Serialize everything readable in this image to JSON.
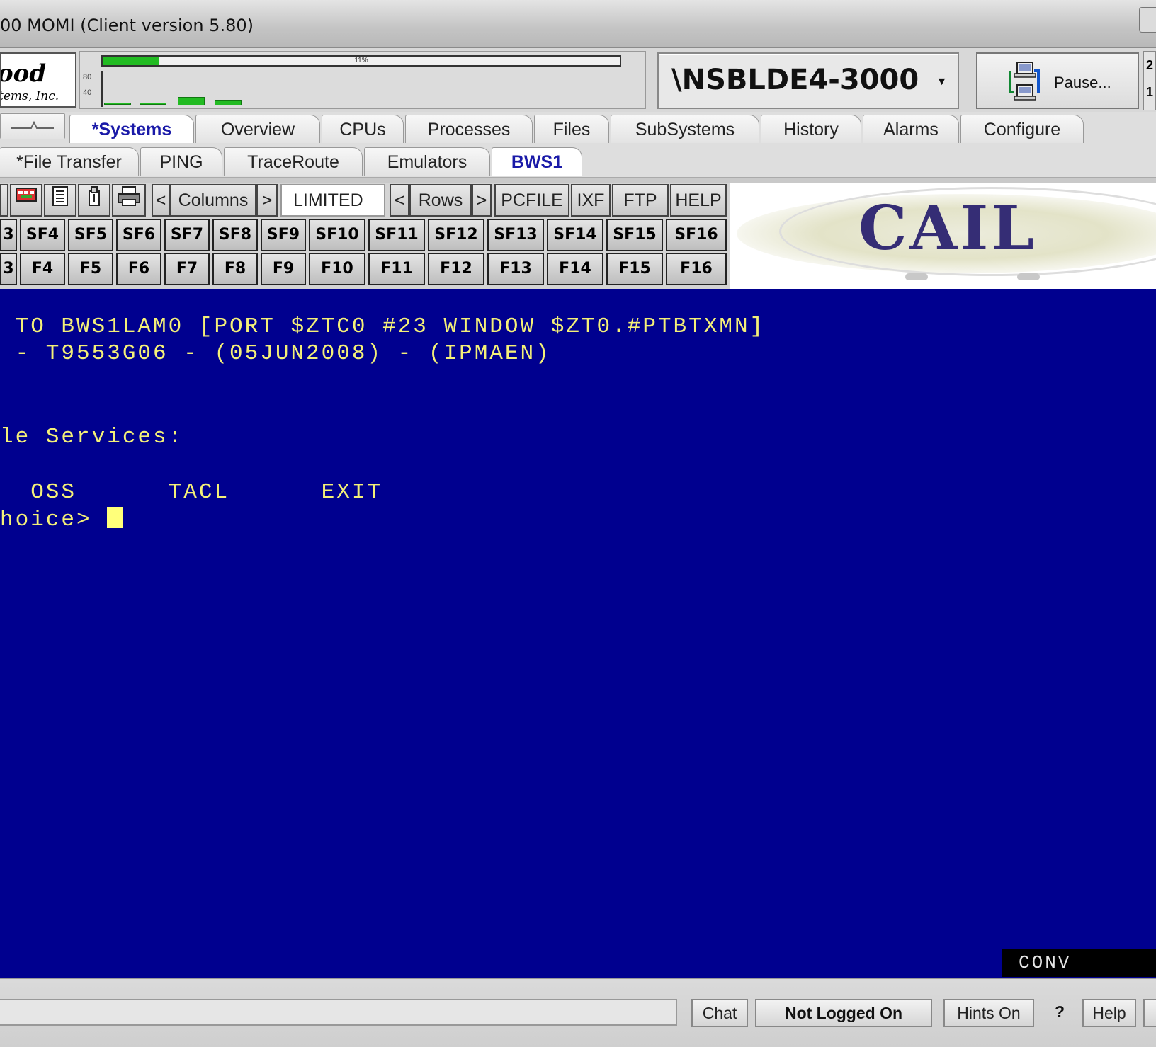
{
  "window": {
    "title": "00 MOMI (Client version 5.80)"
  },
  "logo": {
    "line1": "ood",
    "line2": "tems, Inc."
  },
  "performance": {
    "cpu_busy_label": "11%",
    "cpu_busy_fraction": 0.11,
    "axis_labels": [
      "80",
      "40"
    ],
    "colors": {
      "bar": "#22bb22"
    }
  },
  "node": {
    "name": "\\NSBLDE4-3000",
    "dropdown_icon": "chevron-down-icon"
  },
  "pause": {
    "label": "Pause...",
    "icon": "pause-network-icon"
  },
  "right_stub": [
    "2",
    "1"
  ],
  "tabs_row1": [
    {
      "label": "*Systems",
      "active": true
    },
    {
      "label": "Overview"
    },
    {
      "label": "CPUs"
    },
    {
      "label": "Processes"
    },
    {
      "label": "Files"
    },
    {
      "label": "SubSystems"
    },
    {
      "label": "History"
    },
    {
      "label": "Alarms"
    },
    {
      "label": "Configure"
    }
  ],
  "tabs_row2": [
    {
      "label": "*File Transfer"
    },
    {
      "label": "PING"
    },
    {
      "label": "TraceRoute"
    },
    {
      "label": "Emulators"
    },
    {
      "label": "BWS1",
      "active": true
    }
  ],
  "toolbar": {
    "icons": [
      "color-palette-icon",
      "keyboard-icon",
      "copy-screen-icon",
      "clipboard-paste-icon",
      "print-icon"
    ],
    "columns_prev": "<",
    "columns_label": "Columns",
    "columns_next": ">",
    "mode_value": "LIMITED",
    "rows_prev": "<",
    "rows_label": "Rows",
    "rows_next": ">",
    "pcfile": "PCFILE",
    "ixf": "IXF",
    "ftp": "FTP",
    "help": "HELP"
  },
  "shift_fkeys": [
    "3",
    "SF4",
    "SF5",
    "SF6",
    "SF7",
    "SF8",
    "SF9",
    "SF10",
    "SF11",
    "SF12",
    "SF13",
    "SF14",
    "SF15",
    "SF16"
  ],
  "fkeys": [
    "3",
    "F4",
    "F5",
    "F6",
    "F7",
    "F8",
    "F9",
    "F10",
    "F11",
    "F12",
    "F13",
    "F14",
    "F15",
    "F16"
  ],
  "banner": {
    "text": "CAIL"
  },
  "terminal": {
    "line1": " TO BWS1LAM0 [PORT $ZTC0 #23 WINDOW $ZT0.#PTBTXMN]",
    "line2": " - T9553G06 - (05JUN2008) - (IPMAEN)",
    "line3": "le Services:",
    "line4": "  OSS      TACL      EXIT",
    "prompt": "hoice> ",
    "mode_indicator": "CONV",
    "colors": {
      "background": "#00008f",
      "text": "#f4f078"
    }
  },
  "statusbar": {
    "message": "",
    "chat": "Chat",
    "login_status": "Not Logged On",
    "hints": "Hints On",
    "question": "?",
    "help": "Help"
  }
}
